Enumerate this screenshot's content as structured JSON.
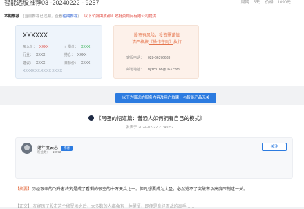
{
  "header": {
    "title": "智能选股推荐03 -20240222 - 9257",
    "period_label": "周期：5天",
    "price_label": "价格：1090元"
  },
  "notice": {
    "label": "本期推荐",
    "status": "(当前推荐已过期，查看",
    "link": "往期推荐",
    "link_suffix": ")",
    "provider": "以下个股由成都汇致投资顾问有限公司提供"
  },
  "stock": {
    "name": "XXXXXX",
    "fields": [
      {
        "label": "买入价：",
        "value": "XXXX"
      },
      {
        "label": "止损价：",
        "value": "XXXX"
      },
      {
        "label": "行业：",
        "value": "XXXX"
      },
      {
        "label": "持仓：",
        "value": "XXXX"
      },
      {
        "label": "建议：",
        "value": "XXXX"
      },
      {
        "label": "目标价：",
        "value": "XXXX"
      }
    ],
    "sub_note": "XXXXX XX.XX.XX XX.XX"
  },
  "risk": {
    "line1": "股市有风险，投资需谨慎",
    "line2_pre": "请严格按",
    "line2_link": "《操作守则》",
    "line2_post": "执行",
    "phone_label": "客服电话：",
    "phone": "028-66376683",
    "email_label": "邮箱地址：",
    "email": "hyzc3188@163.com"
  },
  "banner": {
    "text": "以下为赠送的服务内容及用户效果，与智能产品无关"
  },
  "article": {
    "title": "《阿骚的悟道篇：普通人如何拥有自己的模式》",
    "time": "发表于 2024-02-22 21:49:52",
    "author": {
      "name": "蓬年度云志",
      "tag": "作者",
      "fans_label": "粉丝数：",
      "fans": "19972"
    },
    "follow_label": "关注",
    "summary_tag": "【摘要】",
    "summary_text": "历经艰辛的飞升者终究是成了看剩的很空的十万天兵之一。但凡想要成为大圣，必然逃不了突破市场高度压制这一关。",
    "next_line": "【正文】 在经历了股市这个修罗场之后，大多数的人都会有一种醒悟，即便是身经百战的高手……"
  },
  "colors": {
    "accent": "#2c7be0",
    "warning": "#e5754d",
    "down": "#2fae4d",
    "up": "#e0473d"
  }
}
